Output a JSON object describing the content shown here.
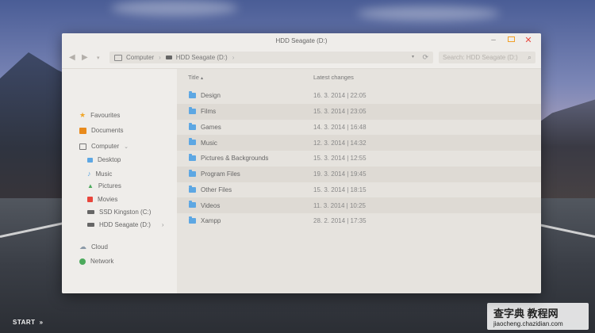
{
  "window": {
    "title": "HDD Seagate (D:)"
  },
  "toolbar": {
    "breadcrumbs": [
      "Computer",
      "HDD Seagate (D:)"
    ],
    "search_placeholder": "Search: HDD Seagate (D:)"
  },
  "sidebar": {
    "items": [
      {
        "label": "Favourites",
        "icon": "star-icon",
        "color": "#f0a628"
      },
      {
        "label": "Documents",
        "icon": "folder-icon",
        "color": "#e88a1c"
      },
      {
        "label": "Computer",
        "icon": "computer-icon",
        "color": "#777777"
      },
      {
        "label": "Desktop",
        "icon": "desktop-icon",
        "color": "#5da7e3"
      },
      {
        "label": "Music",
        "icon": "music-icon",
        "color": "#5da7e3"
      },
      {
        "label": "Pictures",
        "icon": "pictures-icon",
        "color": "#4caa5c"
      },
      {
        "label": "Movies",
        "icon": "movies-icon",
        "color": "#e8463c"
      },
      {
        "label": "SSD Kingston (C:)",
        "icon": "drive-icon",
        "color": "#666666"
      },
      {
        "label": "HDD Seagate (D:)",
        "icon": "drive-icon",
        "color": "#666666"
      },
      {
        "label": "Cloud",
        "icon": "cloud-icon",
        "color": "#8c9aa8"
      },
      {
        "label": "Network",
        "icon": "network-icon",
        "color": "#4caa5c"
      }
    ]
  },
  "columns": {
    "title": "Title",
    "date": "Latest changes"
  },
  "files": [
    {
      "name": "Design",
      "date": "16. 3. 2014 | 22:05"
    },
    {
      "name": "Films",
      "date": "15. 3. 2014 | 23:05"
    },
    {
      "name": "Games",
      "date": "14. 3. 2014 | 16:48"
    },
    {
      "name": "Music",
      "date": "12. 3. 2014 | 14:32"
    },
    {
      "name": "Pictures & Backgrounds",
      "date": "15. 3. 2014 | 12:55"
    },
    {
      "name": "Program Files",
      "date": "19. 3. 2014 | 19:45"
    },
    {
      "name": "Other Files",
      "date": "15. 3. 2014 | 18:15"
    },
    {
      "name": "Videos",
      "date": "11. 3. 2014 | 10:25"
    },
    {
      "name": "Xampp",
      "date": "28. 2. 2014 | 17:35"
    }
  ],
  "taskbar": {
    "start_label": "START"
  },
  "watermark": {
    "text": "查字典 教程网",
    "url": "jiaocheng.chazidian.com"
  }
}
